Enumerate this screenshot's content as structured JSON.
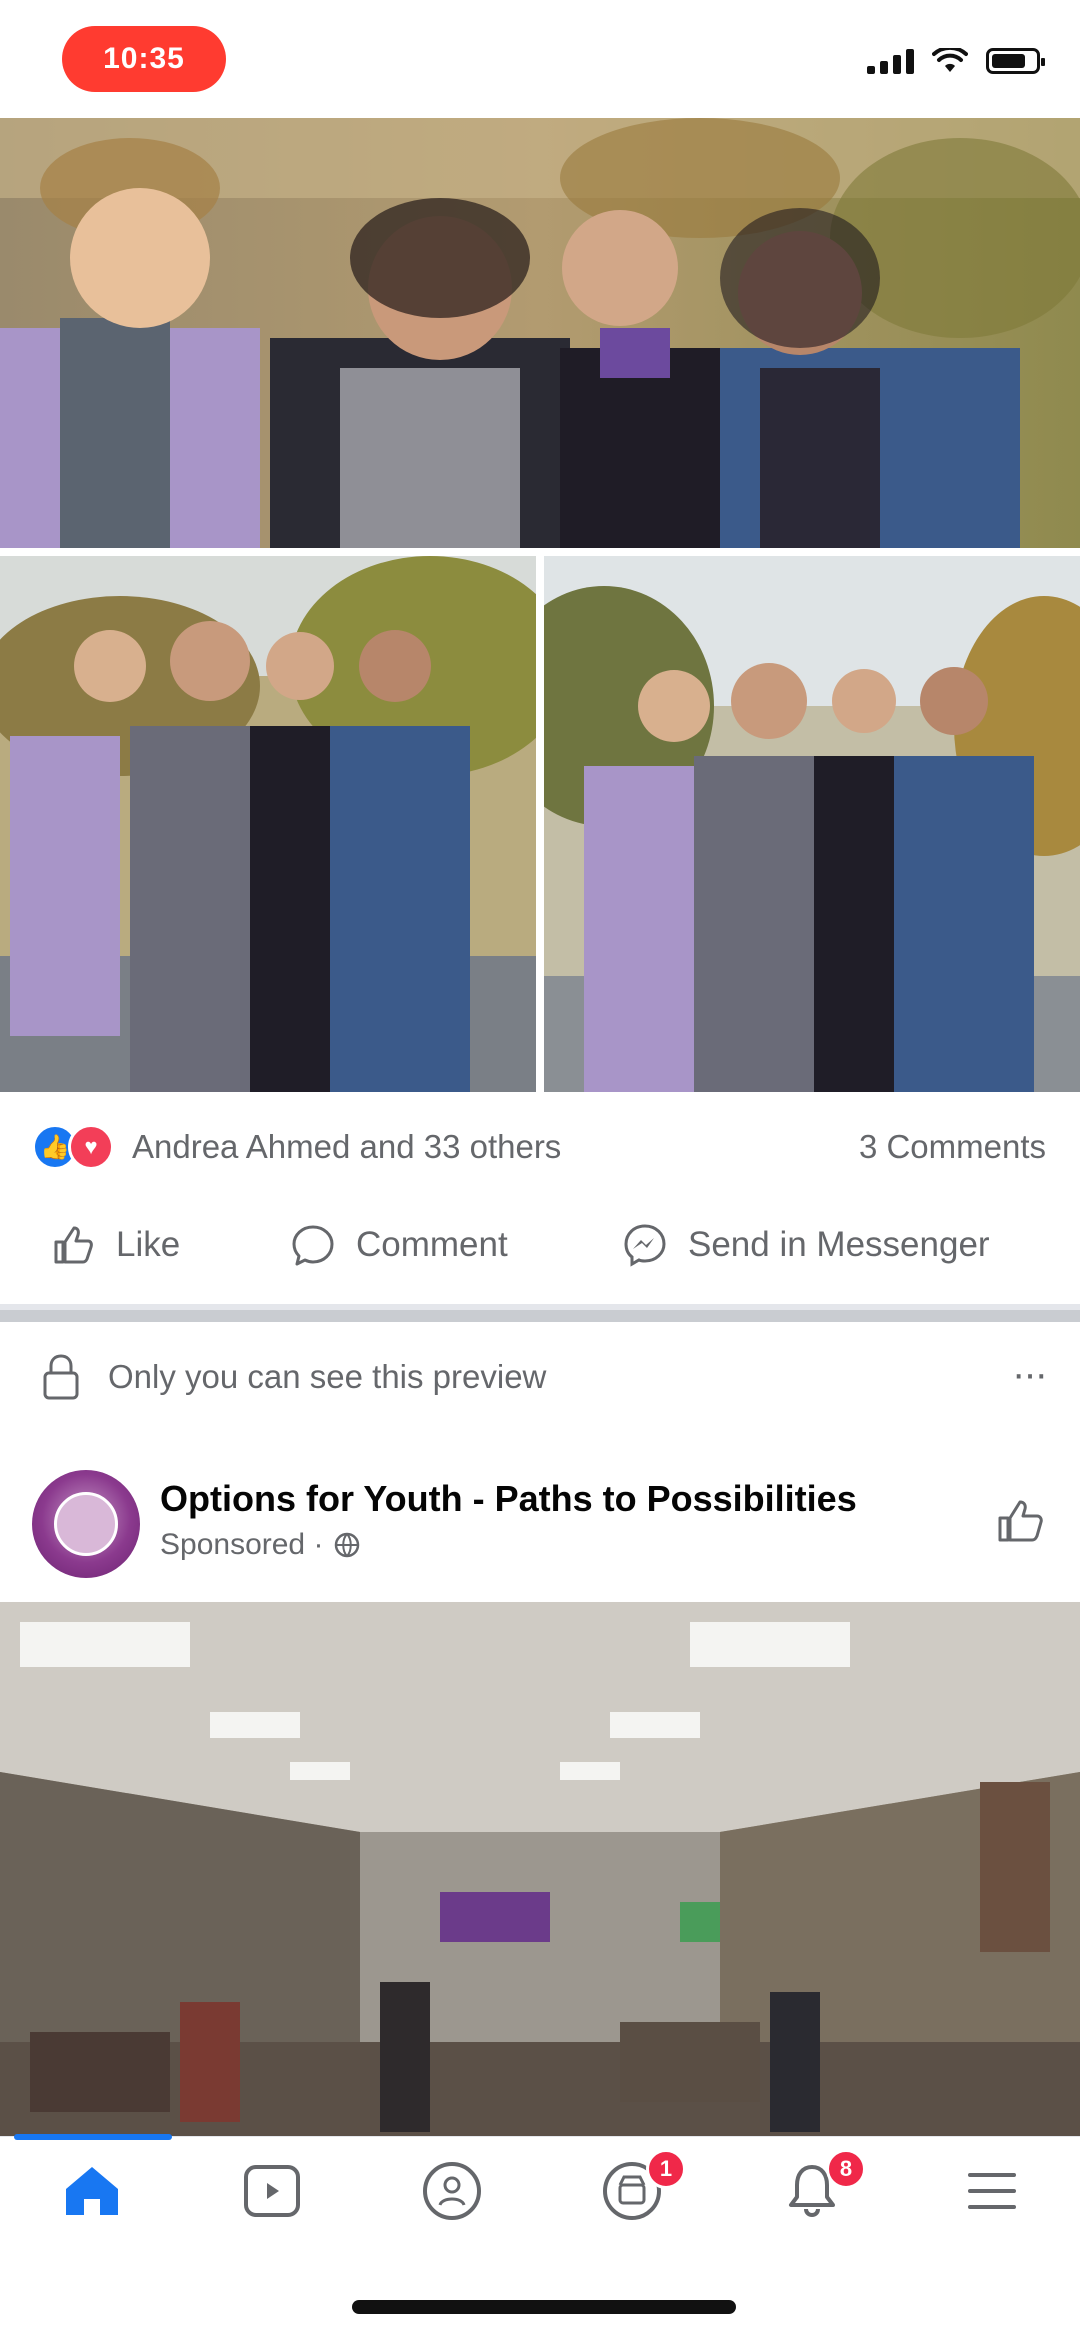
{
  "status_bar": {
    "time": "10:35",
    "signal_icon": "cellular-signal-icon",
    "wifi_icon": "wifi-icon",
    "battery_icon": "battery-icon",
    "battery_level": 0.8
  },
  "post1": {
    "reactions": {
      "like_icon": "like-reaction-icon",
      "love_icon": "love-reaction-icon",
      "text": "Andrea Ahmed and 33 others"
    },
    "comments_count": "3 Comments",
    "actions": {
      "like": "Like",
      "comment": "Comment",
      "send": "Send in Messenger"
    }
  },
  "preview_notice": {
    "text": "Only you can see this preview",
    "more": "···"
  },
  "post2": {
    "page_name": "Options for Youth - Paths to Possibilities",
    "subtitle": "Sponsored ·"
  },
  "tabbar": {
    "active_tab": "home",
    "market_badge": "1",
    "notifications_badge": "8"
  },
  "colors": {
    "accent": "#1877f2",
    "badge": "#f02849",
    "time_pill": "#ff3b30",
    "love": "#f33e58"
  }
}
